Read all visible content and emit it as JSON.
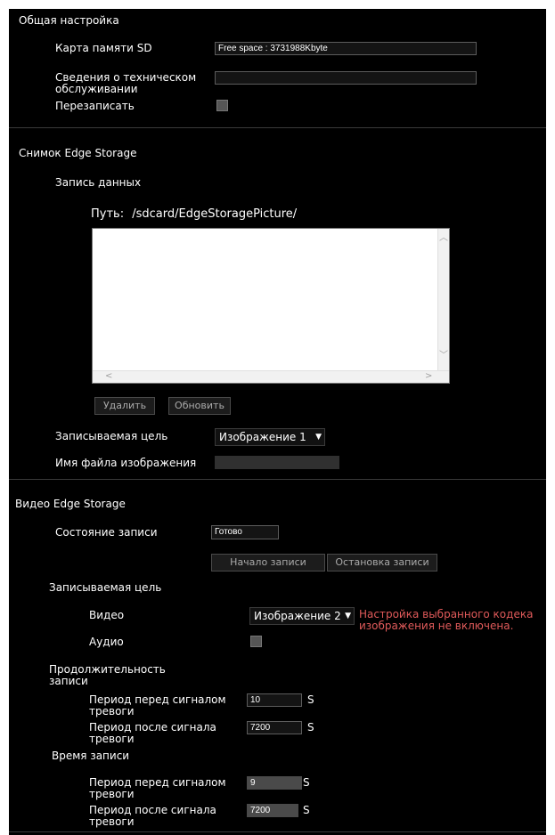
{
  "general": {
    "header": "Общая настройка",
    "sd_label": "Карта памяти SD",
    "sd_value": "Free space : 3731988Kbyte",
    "service_label": "Сведения о техническом обслуживании",
    "service_value": "",
    "overwrite_label": "Перезаписать"
  },
  "snapshot": {
    "header": "Снимок Edge Storage",
    "record_data_label": "Запись данных",
    "path_label": "Путь:",
    "path_value": "/sdcard/EdgeStoragePicture/",
    "delete_button": "Удалить",
    "refresh_button": "Обновить",
    "target_label": "Записываемая цель",
    "target_value": "Изображение 1",
    "filename_label": "Имя файла изображения",
    "filename_value": ""
  },
  "video": {
    "header": "Видео Edge Storage",
    "status_label": "Состояние записи",
    "status_value": "Готово",
    "start_button": "Начало записи",
    "stop_button": "Остановка записи",
    "target_label": "Записываемая цель",
    "video_label": "Видео",
    "video_value": "Изображение 2",
    "warning": "Настройка выбранного кодека изображения не включена.",
    "audio_label": "Аудио",
    "duration_label": "Продолжительность записи",
    "pre_alarm_label": "Период перед сигналом тревоги",
    "pre_alarm_value": "10",
    "post_alarm_label": "Период после сигнала тревоги",
    "post_alarm_value": "7200",
    "time_label": "Время записи",
    "time_pre_label": "Период перед сигналом тревоги",
    "time_pre_value": "9",
    "time_post_label": "Период после сигнала тревоги",
    "time_post_value": "7200",
    "unit": "S"
  }
}
